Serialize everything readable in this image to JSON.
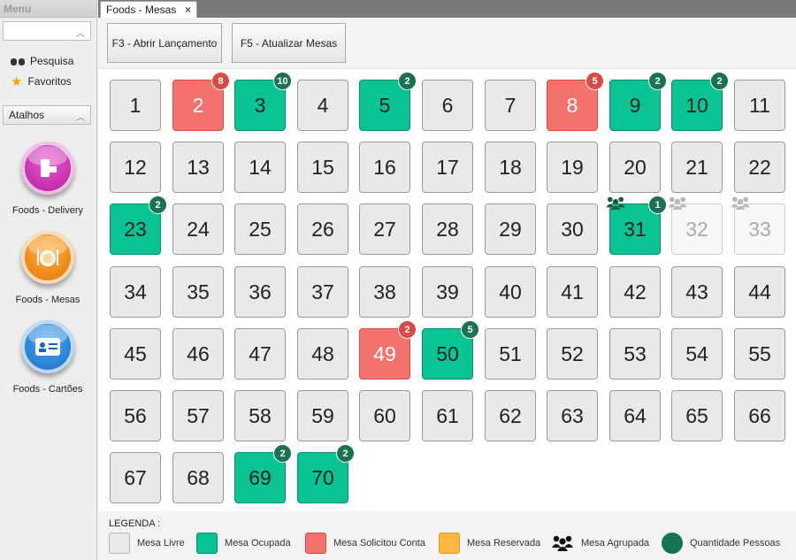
{
  "sidebar": {
    "title": "Menu",
    "links": [
      {
        "label": "Pesquisa",
        "icon": "binoculars-icon"
      },
      {
        "label": "Favoritos",
        "icon": "star-icon"
      }
    ],
    "section_title": "Atalhos",
    "shortcuts": [
      {
        "label": "Foods - Delivery",
        "icon": "delivery-icon"
      },
      {
        "label": "Foods - Mesas",
        "icon": "plate-icon"
      },
      {
        "label": "Foods - Cartões",
        "icon": "card-icon"
      }
    ]
  },
  "tab": {
    "label": "Foods - Mesas",
    "close": "×"
  },
  "toolbar": {
    "open_label": "F3 - Abrir Lançamento",
    "refresh_label": "F5 - Atualizar Mesas"
  },
  "colors": {
    "livre": "#e9e9e9",
    "ocupada": "#09c492",
    "conta": "#f3726c",
    "reservada": "#ffb83f",
    "count_badge": "#1a7350"
  },
  "mesas": [
    {
      "n": "1",
      "status": "livre"
    },
    {
      "n": "2",
      "status": "conta",
      "people": "8"
    },
    {
      "n": "3",
      "status": "ocupada",
      "people": "10"
    },
    {
      "n": "4",
      "status": "livre"
    },
    {
      "n": "5",
      "status": "ocupada",
      "people": "2"
    },
    {
      "n": "6",
      "status": "livre"
    },
    {
      "n": "7",
      "status": "livre"
    },
    {
      "n": "8",
      "status": "conta",
      "people": "5"
    },
    {
      "n": "9",
      "status": "ocupada",
      "people": "2"
    },
    {
      "n": "10",
      "status": "ocupada",
      "people": "2"
    },
    {
      "n": "11",
      "status": "livre"
    },
    {
      "n": "12",
      "status": "livre"
    },
    {
      "n": "13",
      "status": "livre"
    },
    {
      "n": "14",
      "status": "livre"
    },
    {
      "n": "15",
      "status": "livre"
    },
    {
      "n": "16",
      "status": "livre"
    },
    {
      "n": "17",
      "status": "livre"
    },
    {
      "n": "18",
      "status": "livre"
    },
    {
      "n": "19",
      "status": "livre"
    },
    {
      "n": "20",
      "status": "livre"
    },
    {
      "n": "21",
      "status": "livre"
    },
    {
      "n": "22",
      "status": "livre"
    },
    {
      "n": "23",
      "status": "ocupada",
      "people": "2"
    },
    {
      "n": "24",
      "status": "livre"
    },
    {
      "n": "25",
      "status": "livre"
    },
    {
      "n": "26",
      "status": "livre"
    },
    {
      "n": "27",
      "status": "livre"
    },
    {
      "n": "28",
      "status": "livre"
    },
    {
      "n": "29",
      "status": "livre"
    },
    {
      "n": "30",
      "status": "livre"
    },
    {
      "n": "31",
      "status": "ocupada",
      "people": "1",
      "grouped": true
    },
    {
      "n": "32",
      "status": "agrupada",
      "grouped": true
    },
    {
      "n": "33",
      "status": "agrupada",
      "grouped": true
    },
    {
      "n": "34",
      "status": "livre"
    },
    {
      "n": "35",
      "status": "livre"
    },
    {
      "n": "36",
      "status": "livre"
    },
    {
      "n": "37",
      "status": "livre"
    },
    {
      "n": "38",
      "status": "livre"
    },
    {
      "n": "39",
      "status": "livre"
    },
    {
      "n": "40",
      "status": "livre"
    },
    {
      "n": "41",
      "status": "livre"
    },
    {
      "n": "42",
      "status": "livre"
    },
    {
      "n": "43",
      "status": "livre"
    },
    {
      "n": "44",
      "status": "livre"
    },
    {
      "n": "45",
      "status": "livre"
    },
    {
      "n": "46",
      "status": "livre"
    },
    {
      "n": "47",
      "status": "livre"
    },
    {
      "n": "48",
      "status": "livre"
    },
    {
      "n": "49",
      "status": "conta",
      "people": "2"
    },
    {
      "n": "50",
      "status": "ocupada",
      "people": "5"
    },
    {
      "n": "51",
      "status": "livre"
    },
    {
      "n": "52",
      "status": "livre"
    },
    {
      "n": "53",
      "status": "livre"
    },
    {
      "n": "54",
      "status": "livre"
    },
    {
      "n": "55",
      "status": "livre"
    },
    {
      "n": "56",
      "status": "livre"
    },
    {
      "n": "57",
      "status": "livre"
    },
    {
      "n": "58",
      "status": "livre"
    },
    {
      "n": "59",
      "status": "livre"
    },
    {
      "n": "60",
      "status": "livre"
    },
    {
      "n": "61",
      "status": "livre"
    },
    {
      "n": "62",
      "status": "livre"
    },
    {
      "n": "63",
      "status": "livre"
    },
    {
      "n": "64",
      "status": "livre"
    },
    {
      "n": "65",
      "status": "livre"
    },
    {
      "n": "66",
      "status": "livre"
    },
    {
      "n": "67",
      "status": "livre"
    },
    {
      "n": "68",
      "status": "livre"
    },
    {
      "n": "69",
      "status": "ocupada",
      "people": "2"
    },
    {
      "n": "70",
      "status": "ocupada",
      "people": "2"
    }
  ],
  "legend": {
    "title": "LEGENDA :",
    "items": [
      {
        "label": "Mesa Livre",
        "kind": "livre"
      },
      {
        "label": "Mesa Ocupada",
        "kind": "ocupada"
      },
      {
        "label": "Mesa Solicitou Conta",
        "kind": "conta"
      },
      {
        "label": "Mesa Reservada",
        "kind": "reservada"
      },
      {
        "label": "Mesa Agrupada",
        "kind": "agrupada"
      },
      {
        "label": "Quantidade Pessoas",
        "kind": "pessoas"
      }
    ]
  }
}
